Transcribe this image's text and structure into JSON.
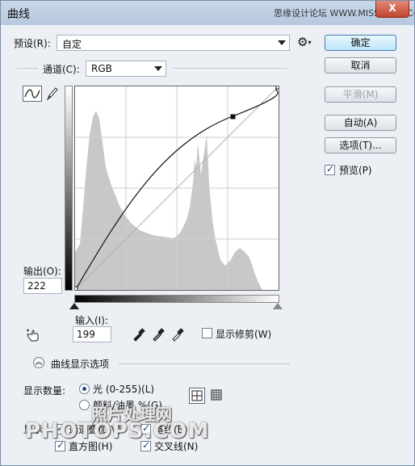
{
  "window": {
    "title": "曲线",
    "close_glyph": "X",
    "watermark_top": "思缘设计论坛 WWW.MISSYUAN.COM"
  },
  "preset": {
    "label": "预设(R):",
    "value": "自定"
  },
  "channel": {
    "label": "通道(C):",
    "value": "RGB"
  },
  "buttons": {
    "ok": "确定",
    "cancel": "取消",
    "smooth": "平滑(M)",
    "auto": "自动(A)",
    "options": "选项(T)..."
  },
  "preview": {
    "label": "预览(P)",
    "checked": true
  },
  "output": {
    "label": "输出(O):",
    "value": "222"
  },
  "input": {
    "label": "输入(I):",
    "value": "199"
  },
  "show_clipping": {
    "label": "显示修剪(W)",
    "checked": false
  },
  "curve_options": {
    "label": "曲线显示选项"
  },
  "show_amount": {
    "label": "显示数量:",
    "option_light": "光 (0-255)(L)",
    "option_pigment": "颜料/油墨 %(G)"
  },
  "show": {
    "label": "显示:",
    "channel_overlay": "通道叠加(V)",
    "baseline": "基线(B)",
    "histogram": "直方图(H)",
    "intersection": "交叉线(N)"
  },
  "watermarks": {
    "cn": "照片处理网",
    "en": "PHOTOPS.COM"
  },
  "colors": {
    "accent": "#3c7fb1",
    "plot_bg": "#ffffff",
    "histogram": "#c8c8c8",
    "grid": "#cfcfcf"
  },
  "icons": [
    "curve-mode-icon",
    "pencil-icon",
    "gear-icon",
    "target-adjust-hand-icon",
    "eyedropper-black-icon",
    "eyedropper-gray-icon",
    "eyedropper-white-icon",
    "expand-chevron-icon",
    "grid-4-icon",
    "grid-10-icon"
  ]
}
